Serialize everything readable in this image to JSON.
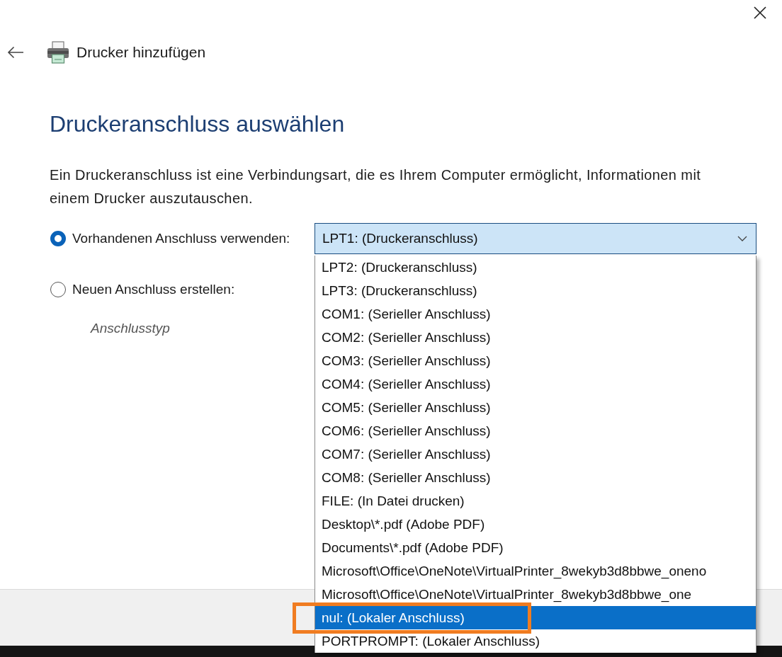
{
  "header": {
    "title": "Drucker hinzufügen"
  },
  "page": {
    "heading": "Druckeranschluss auswählen",
    "description": "Ein Druckeranschluss ist eine Verbindungsart, die es Ihrem Computer ermöglicht, Informationen mit einem Drucker auszutauschen."
  },
  "options": [
    {
      "label": "Vorhandenen Anschluss verwenden:",
      "selected": true
    },
    {
      "label": "Neuen Anschluss erstellen:",
      "selected": false
    }
  ],
  "port_combobox": {
    "value": "LPT1: (Druckeranschluss)",
    "expanded": true,
    "options": [
      {
        "label": "LPT2: (Druckeranschluss)",
        "selected": false,
        "annotated": false
      },
      {
        "label": "LPT3: (Druckeranschluss)",
        "selected": false,
        "annotated": false
      },
      {
        "label": "COM1: (Serieller Anschluss)",
        "selected": false,
        "annotated": false
      },
      {
        "label": "COM2: (Serieller Anschluss)",
        "selected": false,
        "annotated": false
      },
      {
        "label": "COM3: (Serieller Anschluss)",
        "selected": false,
        "annotated": false
      },
      {
        "label": "COM4: (Serieller Anschluss)",
        "selected": false,
        "annotated": false
      },
      {
        "label": "COM5: (Serieller Anschluss)",
        "selected": false,
        "annotated": false
      },
      {
        "label": "COM6: (Serieller Anschluss)",
        "selected": false,
        "annotated": false
      },
      {
        "label": "COM7: (Serieller Anschluss)",
        "selected": false,
        "annotated": false
      },
      {
        "label": "COM8: (Serieller Anschluss)",
        "selected": false,
        "annotated": false
      },
      {
        "label": "FILE: (In Datei drucken)",
        "selected": false,
        "annotated": false
      },
      {
        "label": "Desktop\\*.pdf (Adobe PDF)",
        "selected": false,
        "annotated": false
      },
      {
        "label": "Documents\\*.pdf (Adobe PDF)",
        "selected": false,
        "annotated": false
      },
      {
        "label": "Microsoft\\Office\\OneNote\\VirtualPrinter_8wekyb3d8bbwe_oneno",
        "selected": false,
        "annotated": false
      },
      {
        "label": "Microsoft\\Office\\OneNote\\VirtualPrinter_8wekyb3d8bbwe_one",
        "selected": false,
        "annotated": false
      },
      {
        "label": "nul: (Lokaler Anschluss)",
        "selected": true,
        "annotated": true
      },
      {
        "label": "PORTPROMPT: (Lokaler Anschluss)",
        "selected": false,
        "annotated": false
      }
    ]
  },
  "port_type": {
    "label": "Anschlusstyp"
  }
}
